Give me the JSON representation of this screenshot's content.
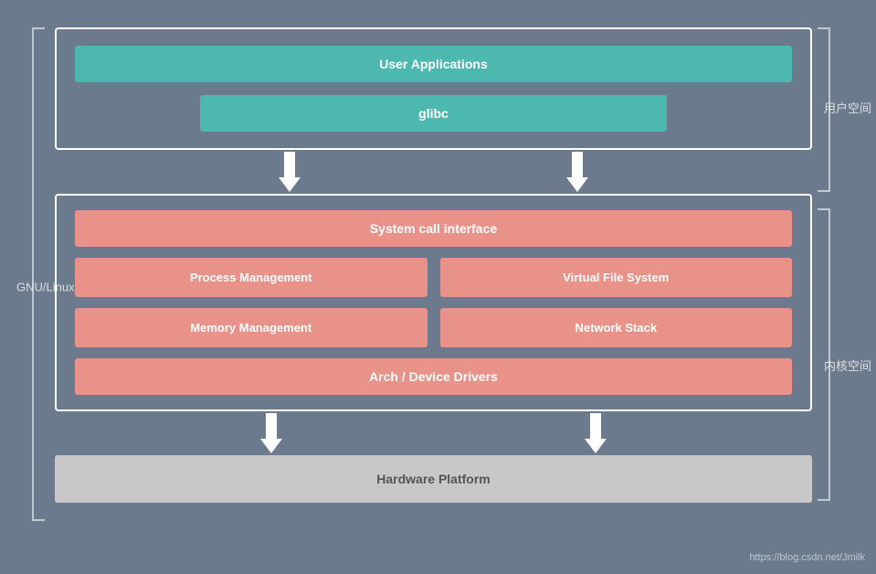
{
  "labels": {
    "gnu_linux": "GNU/Linux",
    "user_space": "用户空间",
    "kernel_space": "内核空间",
    "watermark": "https://blog.csdn.net/Jmilk"
  },
  "boxes": {
    "user_applications": "User Applications",
    "glibc": "glibc",
    "system_call_interface": "System call interface",
    "process_management": "Process Management",
    "virtual_file_system": "Virtual File System",
    "memory_management": "Memory Management",
    "network_stack": "Network Stack",
    "arch_device_drivers": "Arch / Device Drivers",
    "hardware_platform": "Hardware Platform"
  }
}
